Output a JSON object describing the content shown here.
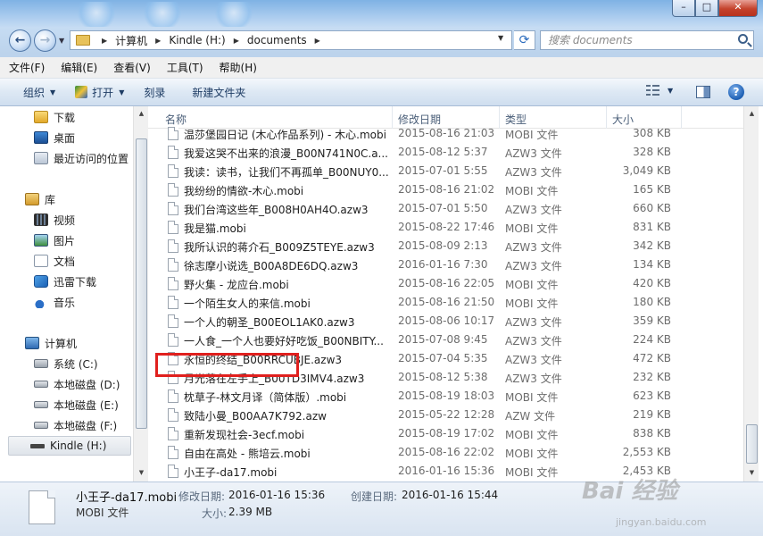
{
  "address": {
    "crumbs": [
      "计算机",
      "Kindle (H:)",
      "documents"
    ],
    "search_placeholder": "搜索 documents"
  },
  "menubar": [
    "文件(F)",
    "编辑(E)",
    "查看(V)",
    "工具(T)",
    "帮助(H)"
  ],
  "toolbar": {
    "organize": "组织",
    "open": "打开",
    "burn": "刻录",
    "new_folder": "新建文件夹"
  },
  "nav": {
    "favorites": [
      {
        "label": "下载",
        "icon": "downloads-folder-icon"
      },
      {
        "label": "桌面",
        "icon": "desktop-icon"
      },
      {
        "label": "最近访问的位置",
        "icon": "recent-places-icon"
      }
    ],
    "library_label": "库",
    "libraries": [
      {
        "label": "视频",
        "icon": "video-library-icon"
      },
      {
        "label": "图片",
        "icon": "pictures-library-icon"
      },
      {
        "label": "文档",
        "icon": "documents-library-icon"
      },
      {
        "label": "迅雷下载",
        "icon": "thunder-download-icon"
      },
      {
        "label": "音乐",
        "icon": "music-library-icon"
      }
    ],
    "computer_label": "计算机",
    "drives": [
      {
        "label": "系统 (C:)",
        "icon": "system-drive-icon"
      },
      {
        "label": "本地磁盘 (D:)",
        "icon": "local-disk-icon"
      },
      {
        "label": "本地磁盘 (E:)",
        "icon": "local-disk-icon"
      },
      {
        "label": "本地磁盘 (F:)",
        "icon": "local-disk-icon"
      },
      {
        "label": "Kindle (H:)",
        "icon": "usb-drive-icon",
        "selected": true
      }
    ]
  },
  "columns": {
    "name": "名称",
    "date": "修改日期",
    "type": "类型",
    "size": "大小"
  },
  "files": [
    {
      "name": "温莎堡园日记 (木心作品系列) - 木心.mobi",
      "date": "2015-08-16 21:03",
      "type": "MOBI 文件",
      "size": "308 KB"
    },
    {
      "name": "我爱这哭不出来的浪漫_B00N741N0C.a...",
      "date": "2015-08-12 5:37",
      "type": "AZW3 文件",
      "size": "328 KB"
    },
    {
      "name": "我读：读书，让我们不再孤单_B00NUY0...",
      "date": "2015-07-01 5:55",
      "type": "AZW3 文件",
      "size": "3,049 KB"
    },
    {
      "name": "我纷纷的情欲-木心.mobi",
      "date": "2015-08-16 21:02",
      "type": "MOBI 文件",
      "size": "165 KB"
    },
    {
      "name": "我们台湾这些年_B008H0AH4O.azw3",
      "date": "2015-07-01 5:50",
      "type": "AZW3 文件",
      "size": "660 KB"
    },
    {
      "name": "我是猫.mobi",
      "date": "2015-08-22 17:46",
      "type": "MOBI 文件",
      "size": "831 KB"
    },
    {
      "name": "我所认识的蒋介石_B009Z5TEYE.azw3",
      "date": "2015-08-09 2:13",
      "type": "AZW3 文件",
      "size": "342 KB"
    },
    {
      "name": "徐志摩小说选_B00A8DE6DQ.azw3",
      "date": "2016-01-16 7:30",
      "type": "AZW3 文件",
      "size": "134 KB"
    },
    {
      "name": "野火集 - 龙应台.mobi",
      "date": "2015-08-16 22:05",
      "type": "MOBI 文件",
      "size": "420 KB"
    },
    {
      "name": "一个陌生女人的来信.mobi",
      "date": "2015-08-16 21:50",
      "type": "MOBI 文件",
      "size": "180 KB"
    },
    {
      "name": "一个人的朝圣_B00EOL1AK0.azw3",
      "date": "2015-08-06 10:17",
      "type": "AZW3 文件",
      "size": "359 KB"
    },
    {
      "name": "一人食_一个人也要好好吃饭_B00NBITY...",
      "date": "2015-07-08 9:45",
      "type": "AZW3 文件",
      "size": "224 KB"
    },
    {
      "name": "永恒的终结_B00RRCUBJE.azw3",
      "date": "2015-07-04 5:35",
      "type": "AZW3 文件",
      "size": "472 KB"
    },
    {
      "name": "月光落在左手上_B00TD3IMV4.azw3",
      "date": "2015-08-12 5:38",
      "type": "AZW3 文件",
      "size": "232 KB"
    },
    {
      "name": "枕草子-林文月译（简体版）.mobi",
      "date": "2015-08-19 18:03",
      "type": "MOBI 文件",
      "size": "623 KB"
    },
    {
      "name": "致陆小曼_B00AA7K792.azw",
      "date": "2015-05-22 12:28",
      "type": "AZW 文件",
      "size": "219 KB"
    },
    {
      "name": "重新发现社会-3ecf.mobi",
      "date": "2015-08-19 17:02",
      "type": "MOBI 文件",
      "size": "838 KB"
    },
    {
      "name": "自由在高处 - 熊培云.mobi",
      "date": "2015-08-16 22:02",
      "type": "MOBI 文件",
      "size": "2,553 KB"
    },
    {
      "name": "小王子-da17.mobi",
      "date": "2016-01-16 15:36",
      "type": "MOBI 文件",
      "size": "2,453 KB"
    }
  ],
  "details": {
    "filename": "小王子-da17.mobi",
    "filetype": "MOBI 文件",
    "modified_label": "修改日期:",
    "modified_value": "2016-01-16 15:36",
    "created_label": "创建日期:",
    "created_value": "2016-01-16 15:44",
    "size_label": "大小:",
    "size_value": "2.39 MB"
  },
  "watermark": {
    "main": "Bai 经验",
    "sub": "jingyan.baidu.com"
  }
}
